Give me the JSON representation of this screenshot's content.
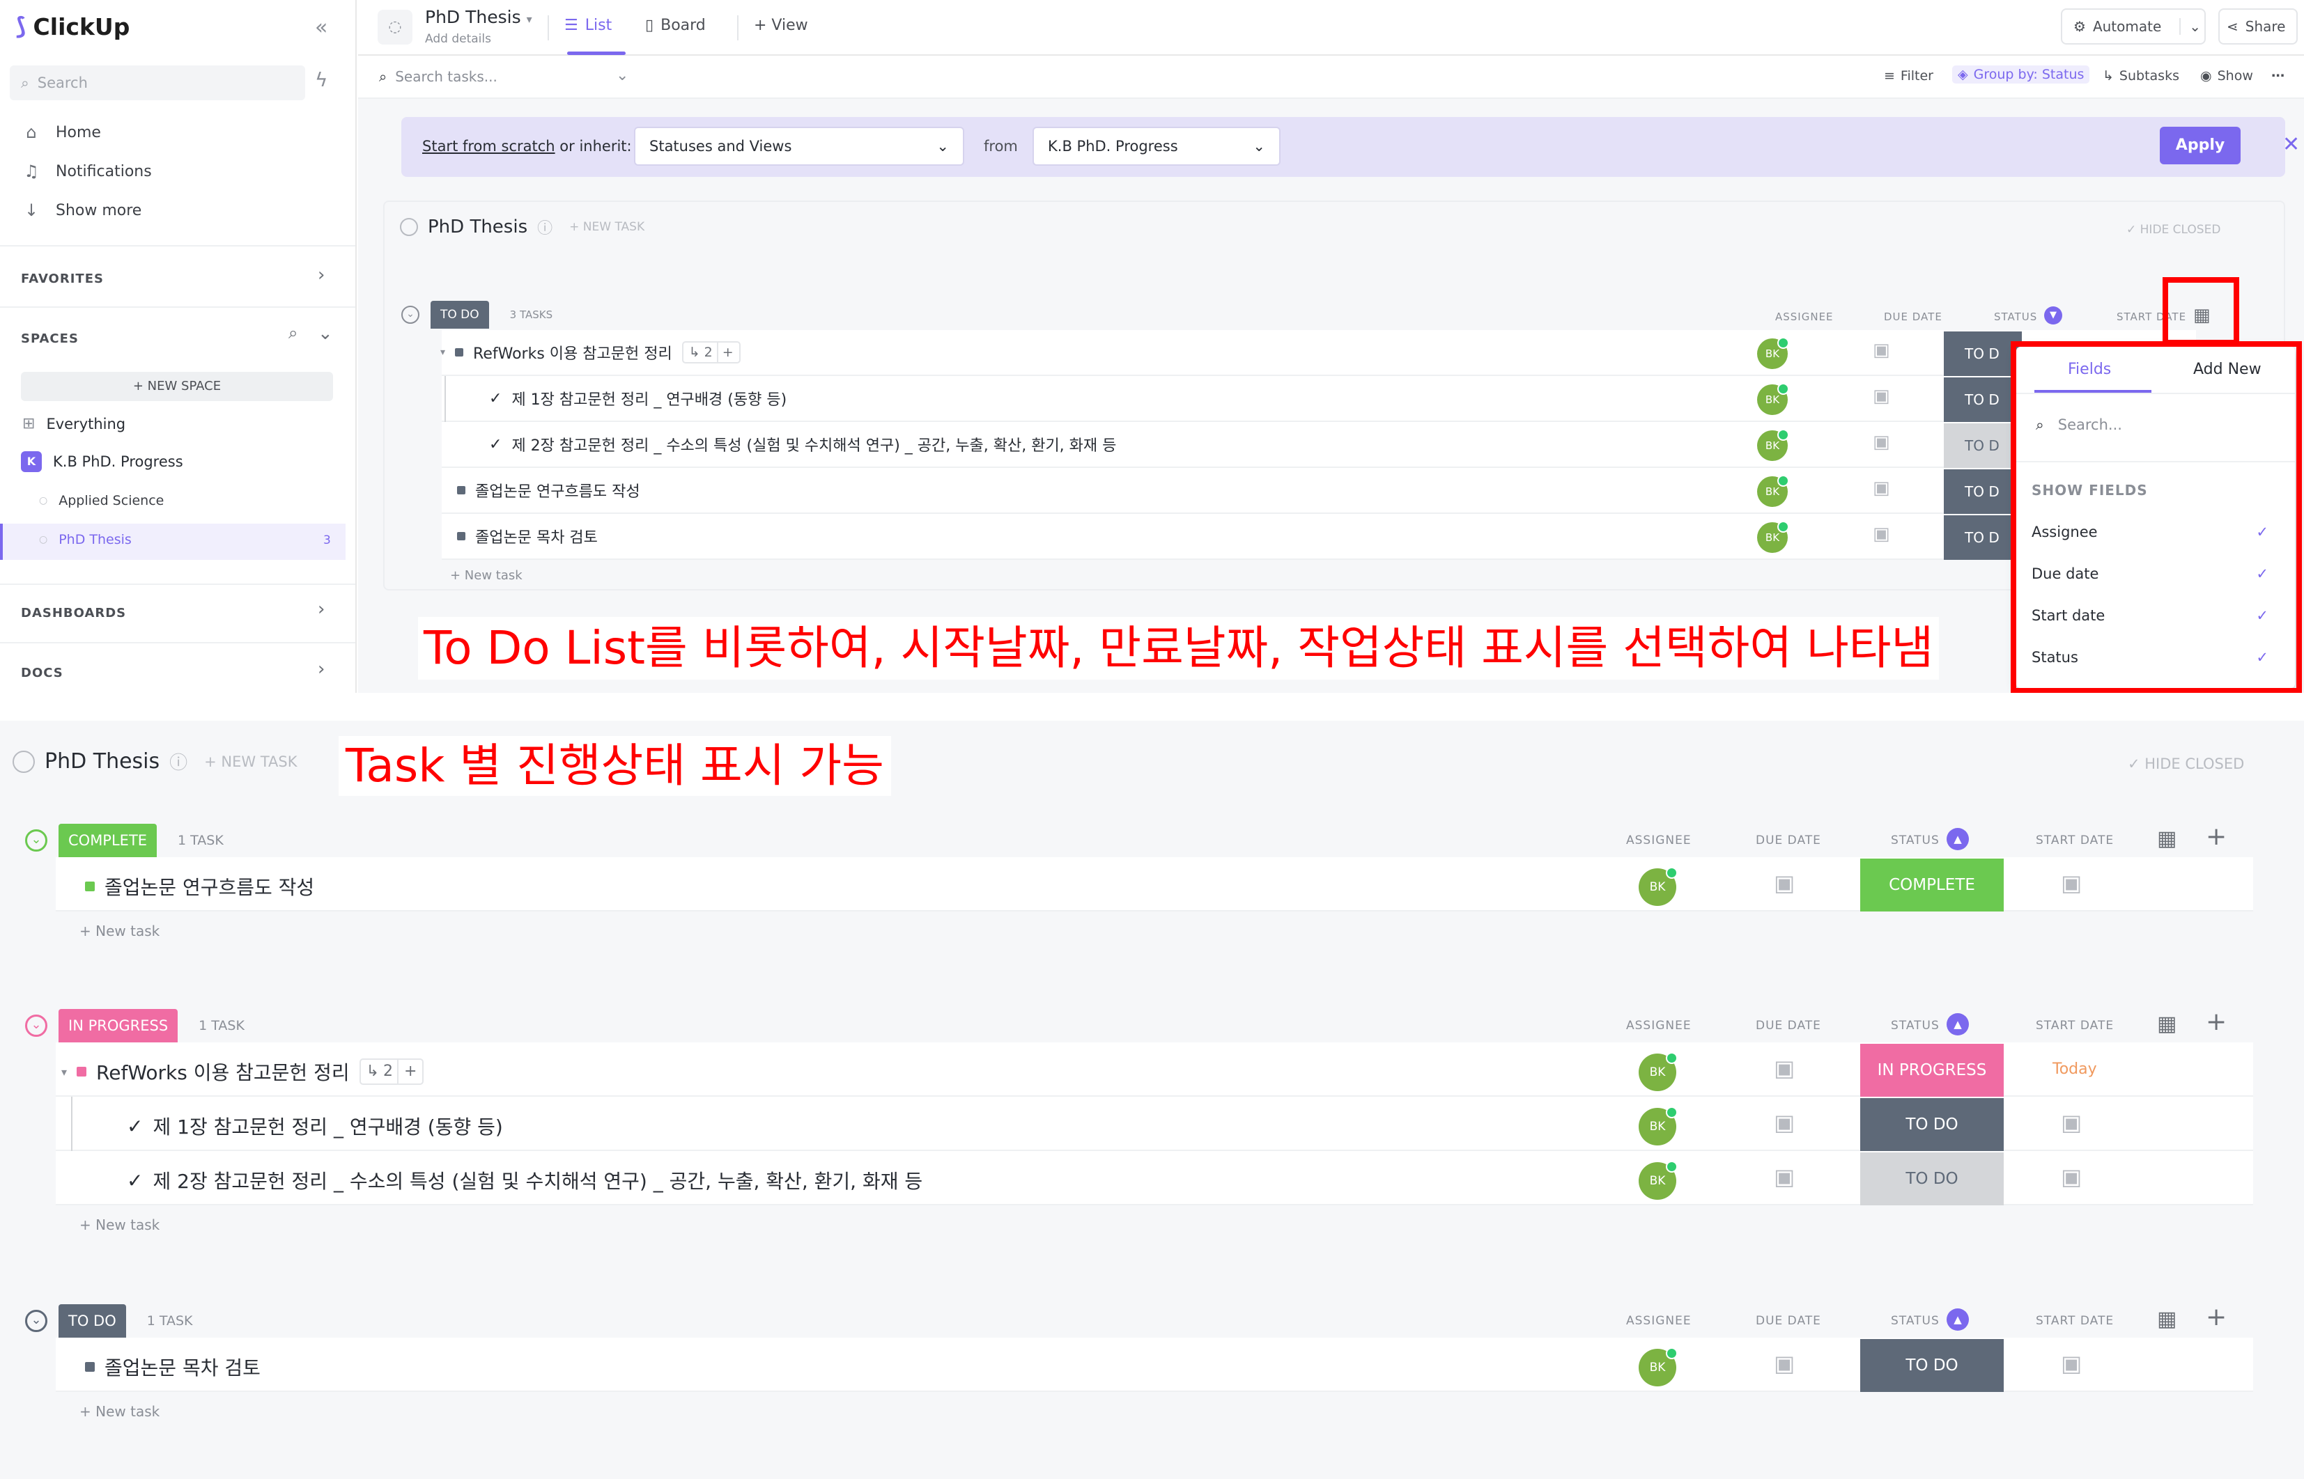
{
  "sidebar": {
    "logo": "ClickUp",
    "search_placeholder": "Search",
    "nav": [
      {
        "label": "Home",
        "icon": "home-icon"
      },
      {
        "label": "Notifications",
        "icon": "bell-icon"
      },
      {
        "label": "Show more",
        "icon": "arrow-down-icon"
      }
    ],
    "favorites": "FAVORITES",
    "spaces": "SPACES",
    "new_space": "+ NEW SPACE",
    "space_items": [
      {
        "label": "Everything"
      },
      {
        "label": "K.B PhD. Progress",
        "badge": "K"
      },
      {
        "label": "Applied Science"
      },
      {
        "label": "PhD Thesis",
        "count": "3"
      }
    ],
    "dashboards": "DASHBOARDS",
    "docs": "DOCS"
  },
  "header": {
    "title": "PhD Thesis",
    "subtitle": "Add details",
    "tabs": [
      {
        "label": "List"
      },
      {
        "label": "Board"
      },
      {
        "label": "+ View"
      }
    ],
    "automate": "Automate",
    "share": "Share"
  },
  "toolbar": {
    "search_placeholder": "Search tasks...",
    "filter": "Filter",
    "group_by": "Group by: Status",
    "subtasks": "Subtasks",
    "show": "Show"
  },
  "inherit_bar": {
    "label_link": "Start from scratch",
    "label_rest": " or inherit:",
    "select_value": "Statuses and Views",
    "from": "from",
    "from_value": "K.B PhD. Progress",
    "apply": "Apply"
  },
  "top_list": {
    "title": "PhD Thesis",
    "new_task": "+ NEW TASK",
    "hide_closed": "✓ HIDE CLOSED",
    "group_label": "TO DO",
    "group_count": "3 TASKS",
    "columns": [
      "ASSIGNEE",
      "DUE DATE",
      "STATUS",
      "START DATE"
    ],
    "tasks": [
      {
        "name": "RefWorks 이용 참고문헌 정리",
        "subtasks": "2",
        "status": "TO D",
        "level": 0
      },
      {
        "name": "제 1장 참고문헌 정리 _ 연구배경 (동향 등)",
        "status": "TO D",
        "level": 1
      },
      {
        "name": "제 2장 참고문헌 정리 _ 수소의 특성 (실험 및 수치해석 연구) _ 공간, 누출, 확산, 환기, 화재 등",
        "status": "TO D",
        "level": 1
      },
      {
        "name": "졸업논문 연구흐름도 작성",
        "status": "TO D",
        "level": 0
      },
      {
        "name": "졸업논문 목차 검토",
        "status": "TO D",
        "level": 0
      }
    ],
    "assignee": "BK",
    "add_task": "+ New task"
  },
  "popup": {
    "tab_fields": "Fields",
    "tab_add": "Add New",
    "search_placeholder": "Search...",
    "section": "SHOW FIELDS",
    "fields": [
      "Assignee",
      "Due date",
      "Start date",
      "Status"
    ]
  },
  "annotations": {
    "top": "To Do List를 비롯하여, 시작날짜, 만료날짜, 작업상태 표시를 선택하여 나타냄",
    "bottom": "Task 별 진행상태 표시 가능"
  },
  "bottom_list": {
    "title": "PhD Thesis",
    "new_task": "+ NEW TASK",
    "hide_closed": "✓ HIDE CLOSED",
    "columns": [
      "ASSIGNEE",
      "DUE DATE",
      "STATUS",
      "START DATE"
    ],
    "groups": [
      {
        "label": "COMPLETE",
        "count": "1 TASK",
        "color": "#6bc950",
        "tasks": [
          {
            "name": "졸업논문 연구흐름도 작성",
            "status": "COMPLETE",
            "status_color": "#6bc950"
          }
        ]
      },
      {
        "label": "IN PROGRESS",
        "count": "1 TASK",
        "color": "#f06ca3",
        "tasks": [
          {
            "name": "RefWorks 이용 참고문헌 정리",
            "subtasks": "2",
            "status": "IN PROGRESS",
            "status_color": "#f06ca3",
            "start": "Today"
          },
          {
            "name": "제 1장 참고문헌 정리 _ 연구배경 (동향 등)",
            "status": "TO DO",
            "status_color": "#5e6978"
          },
          {
            "name": "제 2장 참고문헌 정리 _ 수소의 특성 (실험 및 수치해석 연구) _ 공간, 누출, 확산, 환기, 화재 등",
            "status": "TO DO",
            "status_color": "#d4d6d9"
          }
        ]
      },
      {
        "label": "TO DO",
        "count": "1 TASK",
        "color": "#5e6978",
        "tasks": [
          {
            "name": "졸업논문 목차 검토",
            "status": "TO DO",
            "status_color": "#5e6978"
          }
        ]
      }
    ],
    "assignee": "BK",
    "add_task": "+ New task"
  }
}
